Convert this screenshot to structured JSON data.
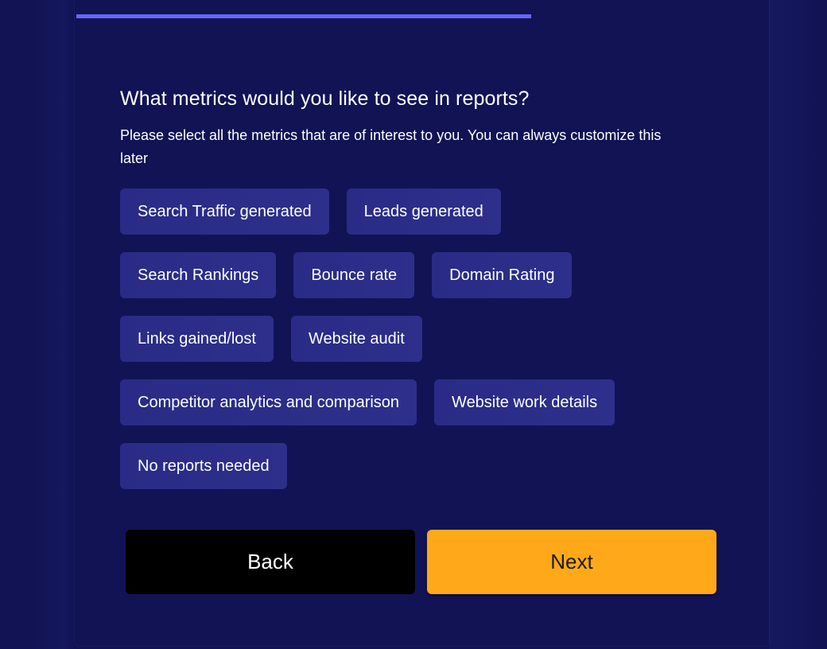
{
  "progress": {
    "fraction": 0.657
  },
  "colors": {
    "background": "#111354",
    "progress": "#6468f5",
    "chip": "#2a2c87",
    "back_button": "#000000",
    "next_button": "#ffa91a"
  },
  "question": {
    "title": "What metrics would you like to see in reports?",
    "subtitle": "Please select all the metrics that are of interest to you. You can always customize this later"
  },
  "options": {
    "rows": [
      [
        "Search Traffic generated",
        "Leads generated"
      ],
      [
        "Search Rankings",
        "Bounce rate",
        "Domain Rating"
      ],
      [
        "Links gained/lost",
        "Website audit"
      ],
      [
        "Competitor analytics and comparison",
        "Website work details"
      ],
      [
        "No reports needed"
      ]
    ]
  },
  "buttons": {
    "back_label": "Back",
    "next_label": "Next"
  }
}
